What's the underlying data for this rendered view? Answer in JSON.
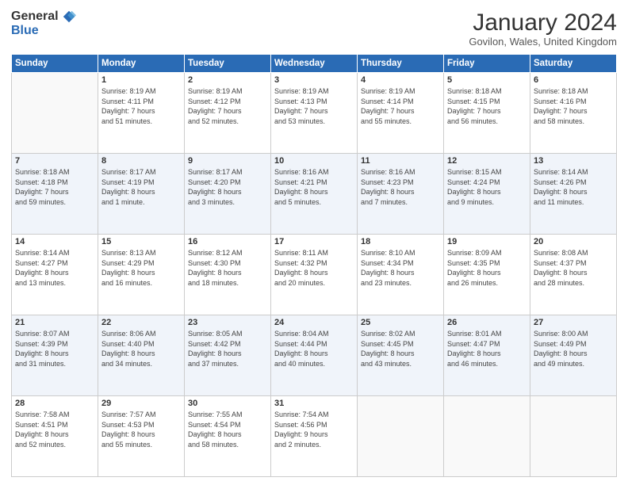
{
  "header": {
    "logo_general": "General",
    "logo_blue": "Blue",
    "month_title": "January 2024",
    "location": "Govilon, Wales, United Kingdom"
  },
  "weekdays": [
    "Sunday",
    "Monday",
    "Tuesday",
    "Wednesday",
    "Thursday",
    "Friday",
    "Saturday"
  ],
  "weeks": [
    [
      {
        "day": "",
        "empty": true
      },
      {
        "day": "1",
        "sunrise": "Sunrise: 8:19 AM",
        "sunset": "Sunset: 4:11 PM",
        "daylight": "Daylight: 7 hours and 51 minutes."
      },
      {
        "day": "2",
        "sunrise": "Sunrise: 8:19 AM",
        "sunset": "Sunset: 4:12 PM",
        "daylight": "Daylight: 7 hours and 52 minutes."
      },
      {
        "day": "3",
        "sunrise": "Sunrise: 8:19 AM",
        "sunset": "Sunset: 4:13 PM",
        "daylight": "Daylight: 7 hours and 53 minutes."
      },
      {
        "day": "4",
        "sunrise": "Sunrise: 8:19 AM",
        "sunset": "Sunset: 4:14 PM",
        "daylight": "Daylight: 7 hours and 55 minutes."
      },
      {
        "day": "5",
        "sunrise": "Sunrise: 8:18 AM",
        "sunset": "Sunset: 4:15 PM",
        "daylight": "Daylight: 7 hours and 56 minutes."
      },
      {
        "day": "6",
        "sunrise": "Sunrise: 8:18 AM",
        "sunset": "Sunset: 4:16 PM",
        "daylight": "Daylight: 7 hours and 58 minutes."
      }
    ],
    [
      {
        "day": "7",
        "sunrise": "Sunrise: 8:18 AM",
        "sunset": "Sunset: 4:18 PM",
        "daylight": "Daylight: 7 hours and 59 minutes."
      },
      {
        "day": "8",
        "sunrise": "Sunrise: 8:17 AM",
        "sunset": "Sunset: 4:19 PM",
        "daylight": "Daylight: 8 hours and 1 minute."
      },
      {
        "day": "9",
        "sunrise": "Sunrise: 8:17 AM",
        "sunset": "Sunset: 4:20 PM",
        "daylight": "Daylight: 8 hours and 3 minutes."
      },
      {
        "day": "10",
        "sunrise": "Sunrise: 8:16 AM",
        "sunset": "Sunset: 4:21 PM",
        "daylight": "Daylight: 8 hours and 5 minutes."
      },
      {
        "day": "11",
        "sunrise": "Sunrise: 8:16 AM",
        "sunset": "Sunset: 4:23 PM",
        "daylight": "Daylight: 8 hours and 7 minutes."
      },
      {
        "day": "12",
        "sunrise": "Sunrise: 8:15 AM",
        "sunset": "Sunset: 4:24 PM",
        "daylight": "Daylight: 8 hours and 9 minutes."
      },
      {
        "day": "13",
        "sunrise": "Sunrise: 8:14 AM",
        "sunset": "Sunset: 4:26 PM",
        "daylight": "Daylight: 8 hours and 11 minutes."
      }
    ],
    [
      {
        "day": "14",
        "sunrise": "Sunrise: 8:14 AM",
        "sunset": "Sunset: 4:27 PM",
        "daylight": "Daylight: 8 hours and 13 minutes."
      },
      {
        "day": "15",
        "sunrise": "Sunrise: 8:13 AM",
        "sunset": "Sunset: 4:29 PM",
        "daylight": "Daylight: 8 hours and 16 minutes."
      },
      {
        "day": "16",
        "sunrise": "Sunrise: 8:12 AM",
        "sunset": "Sunset: 4:30 PM",
        "daylight": "Daylight: 8 hours and 18 minutes."
      },
      {
        "day": "17",
        "sunrise": "Sunrise: 8:11 AM",
        "sunset": "Sunset: 4:32 PM",
        "daylight": "Daylight: 8 hours and 20 minutes."
      },
      {
        "day": "18",
        "sunrise": "Sunrise: 8:10 AM",
        "sunset": "Sunset: 4:34 PM",
        "daylight": "Daylight: 8 hours and 23 minutes."
      },
      {
        "day": "19",
        "sunrise": "Sunrise: 8:09 AM",
        "sunset": "Sunset: 4:35 PM",
        "daylight": "Daylight: 8 hours and 26 minutes."
      },
      {
        "day": "20",
        "sunrise": "Sunrise: 8:08 AM",
        "sunset": "Sunset: 4:37 PM",
        "daylight": "Daylight: 8 hours and 28 minutes."
      }
    ],
    [
      {
        "day": "21",
        "sunrise": "Sunrise: 8:07 AM",
        "sunset": "Sunset: 4:39 PM",
        "daylight": "Daylight: 8 hours and 31 minutes."
      },
      {
        "day": "22",
        "sunrise": "Sunrise: 8:06 AM",
        "sunset": "Sunset: 4:40 PM",
        "daylight": "Daylight: 8 hours and 34 minutes."
      },
      {
        "day": "23",
        "sunrise": "Sunrise: 8:05 AM",
        "sunset": "Sunset: 4:42 PM",
        "daylight": "Daylight: 8 hours and 37 minutes."
      },
      {
        "day": "24",
        "sunrise": "Sunrise: 8:04 AM",
        "sunset": "Sunset: 4:44 PM",
        "daylight": "Daylight: 8 hours and 40 minutes."
      },
      {
        "day": "25",
        "sunrise": "Sunrise: 8:02 AM",
        "sunset": "Sunset: 4:45 PM",
        "daylight": "Daylight: 8 hours and 43 minutes."
      },
      {
        "day": "26",
        "sunrise": "Sunrise: 8:01 AM",
        "sunset": "Sunset: 4:47 PM",
        "daylight": "Daylight: 8 hours and 46 minutes."
      },
      {
        "day": "27",
        "sunrise": "Sunrise: 8:00 AM",
        "sunset": "Sunset: 4:49 PM",
        "daylight": "Daylight: 8 hours and 49 minutes."
      }
    ],
    [
      {
        "day": "28",
        "sunrise": "Sunrise: 7:58 AM",
        "sunset": "Sunset: 4:51 PM",
        "daylight": "Daylight: 8 hours and 52 minutes."
      },
      {
        "day": "29",
        "sunrise": "Sunrise: 7:57 AM",
        "sunset": "Sunset: 4:53 PM",
        "daylight": "Daylight: 8 hours and 55 minutes."
      },
      {
        "day": "30",
        "sunrise": "Sunrise: 7:55 AM",
        "sunset": "Sunset: 4:54 PM",
        "daylight": "Daylight: 8 hours and 58 minutes."
      },
      {
        "day": "31",
        "sunrise": "Sunrise: 7:54 AM",
        "sunset": "Sunset: 4:56 PM",
        "daylight": "Daylight: 9 hours and 2 minutes."
      },
      {
        "day": "",
        "empty": true
      },
      {
        "day": "",
        "empty": true
      },
      {
        "day": "",
        "empty": true
      }
    ]
  ]
}
